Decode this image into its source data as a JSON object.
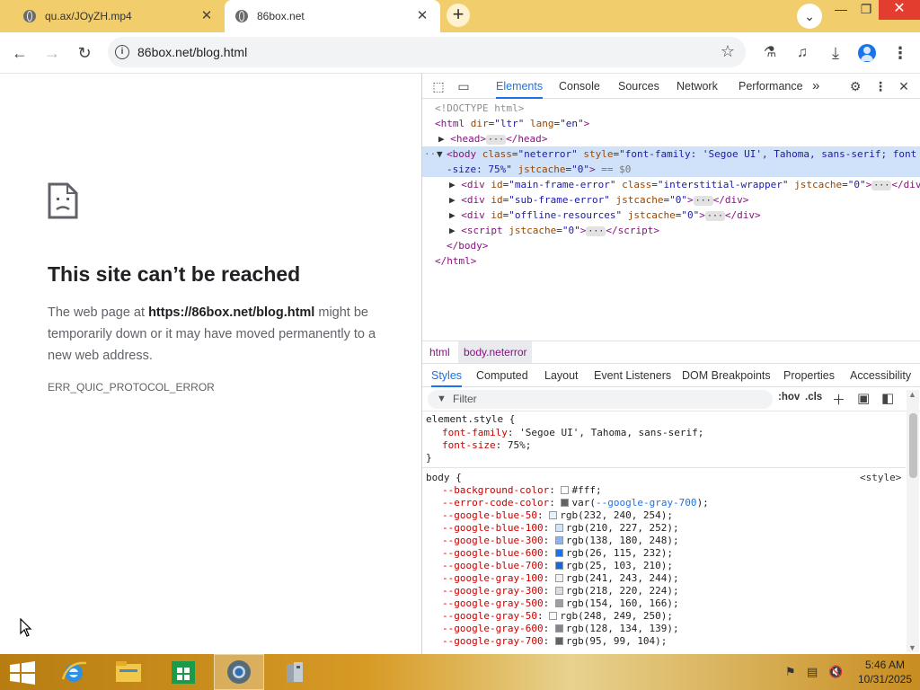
{
  "browser": {
    "tabs": [
      {
        "title": "qu.ax/JOyZH.mp4",
        "active": false
      },
      {
        "title": "86box.net",
        "active": true
      }
    ],
    "new_tab_label": "+",
    "url": "86box.net/blog.html",
    "icons": [
      "globe-icon",
      "close-icon",
      "plus-icon",
      "chevron-down-icon",
      "back-arrow-icon",
      "forward-arrow-icon",
      "reload-icon",
      "info-icon",
      "star-icon",
      "flask-icon",
      "media-icon",
      "download-icon",
      "profile-icon",
      "kebab-menu-icon"
    ]
  },
  "error_page": {
    "title": "This site can’t be reached",
    "desc_prefix": "The web page at ",
    "desc_url": "https://86box.net/blog.html",
    "desc_suffix": " might be temporarily down or it may have moved permanently to a new web address.",
    "code": "ERR_QUIC_PROTOCOL_ERROR"
  },
  "devtools": {
    "tabs": [
      "Elements",
      "Console",
      "Sources",
      "Network",
      "Performance"
    ],
    "active_tab": "Elements",
    "more": "»",
    "dom": {
      "doctype": "<!DOCTYPE html>",
      "html_open": {
        "tag": "html",
        "a1": "dir",
        "v1": "\"ltr\"",
        "a2": "lang",
        "v2": "\"en\""
      },
      "head": {
        "tag": "head"
      },
      "body_open": {
        "tag": "body",
        "a1": "class",
        "v1": "\"neterror\"",
        "a2": "style",
        "v2_1": "\"font-family: 'Segoe UI', Tahoma, sans-serif; font",
        "v2_2": "-size: 75%\"",
        "a3": "jstcache",
        "v3": "\"0\"",
        "marker": "== $0"
      },
      "div1": {
        "tag": "div",
        "a1": "id",
        "v1": "\"main-frame-error\"",
        "a2": "class",
        "v2": "\"interstitial-wrapper\"",
        "a3": "jstcache",
        "v3": "\"0\""
      },
      "div2": {
        "tag": "div",
        "a1": "id",
        "v1": "\"sub-frame-error\"",
        "a2": "jstcache",
        "v2": "\"0\""
      },
      "div3": {
        "tag": "div",
        "a1": "id",
        "v1": "\"offline-resources\"",
        "a2": "jstcache",
        "v2": "\"0\""
      },
      "script": {
        "tag": "script",
        "a1": "jstcache",
        "v1": "\"0\""
      },
      "body_close": "</body>",
      "html_close": "</html>"
    },
    "breadcrumbs": [
      "html",
      "body.neterror"
    ],
    "sub_tabs": [
      "Styles",
      "Computed",
      "Layout",
      "Event Listeners",
      "DOM Breakpoints",
      "Properties",
      "Accessibility"
    ],
    "active_sub_tab": "Styles",
    "filter_placeholder": "Filter",
    "filter_buttons": [
      ":hov",
      ".cls"
    ],
    "element_style": {
      "selector": "element.style {",
      "props": [
        {
          "name": "font-family",
          "value": "'Segoe UI', Tahoma, sans-serif;"
        },
        {
          "name": "font-size",
          "value": "75%;"
        }
      ],
      "close": "}"
    },
    "body_rule": {
      "selector": "body {",
      "source": "<style>",
      "props": [
        {
          "name": "--background-color",
          "value": "#fff;",
          "swatch": "#ffffff"
        },
        {
          "name": "--error-code-color",
          "value_prefix": "var(",
          "value_link": "--google-gray-700",
          "value_suffix": ");",
          "swatch": "#5f6368"
        },
        {
          "name": "--google-blue-50",
          "value": "rgb(232, 240, 254);",
          "swatch": "#e8f0fe"
        },
        {
          "name": "--google-blue-100",
          "value": "rgb(210, 227, 252);",
          "swatch": "#d2e3fc"
        },
        {
          "name": "--google-blue-300",
          "value": "rgb(138, 180, 248);",
          "swatch": "#8ab4f8"
        },
        {
          "name": "--google-blue-600",
          "value": "rgb(26, 115, 232);",
          "swatch": "#1a73e8"
        },
        {
          "name": "--google-blue-700",
          "value": "rgb(25, 103, 210);",
          "swatch": "#1967d2"
        },
        {
          "name": "--google-gray-100",
          "value": "rgb(241, 243, 244);",
          "swatch": "#f1f3f4"
        },
        {
          "name": "--google-gray-300",
          "value": "rgb(218, 220, 224);",
          "swatch": "#dadce0"
        },
        {
          "name": "--google-gray-500",
          "value": "rgb(154, 160, 166);",
          "swatch": "#9aa0a6"
        },
        {
          "name": "--google-gray-50",
          "value": "rgb(248, 249, 250);",
          "swatch": "#f8f9fa"
        },
        {
          "name": "--google-gray-600",
          "value": "rgb(128, 134, 139);",
          "swatch": "#80868b"
        },
        {
          "name": "--google-gray-700",
          "value": "rgb(95, 99, 104);",
          "swatch": "#5f6368"
        }
      ]
    }
  },
  "taskbar": {
    "apps": [
      "windows-start-icon",
      "internet-explorer-icon",
      "file-explorer-icon",
      "store-icon",
      "chrome-icon",
      "app-icon"
    ],
    "clock_time": "5:46 AM",
    "clock_date": "10/31/2025"
  },
  "colors": {
    "titlebar": "#f1cd6c",
    "close_button": "#e23d2f",
    "accent": "#1a73e8",
    "tag": "#881280",
    "attr": "#994500",
    "attr_value": "#1a1aa6",
    "css_prop": "#c80000"
  }
}
